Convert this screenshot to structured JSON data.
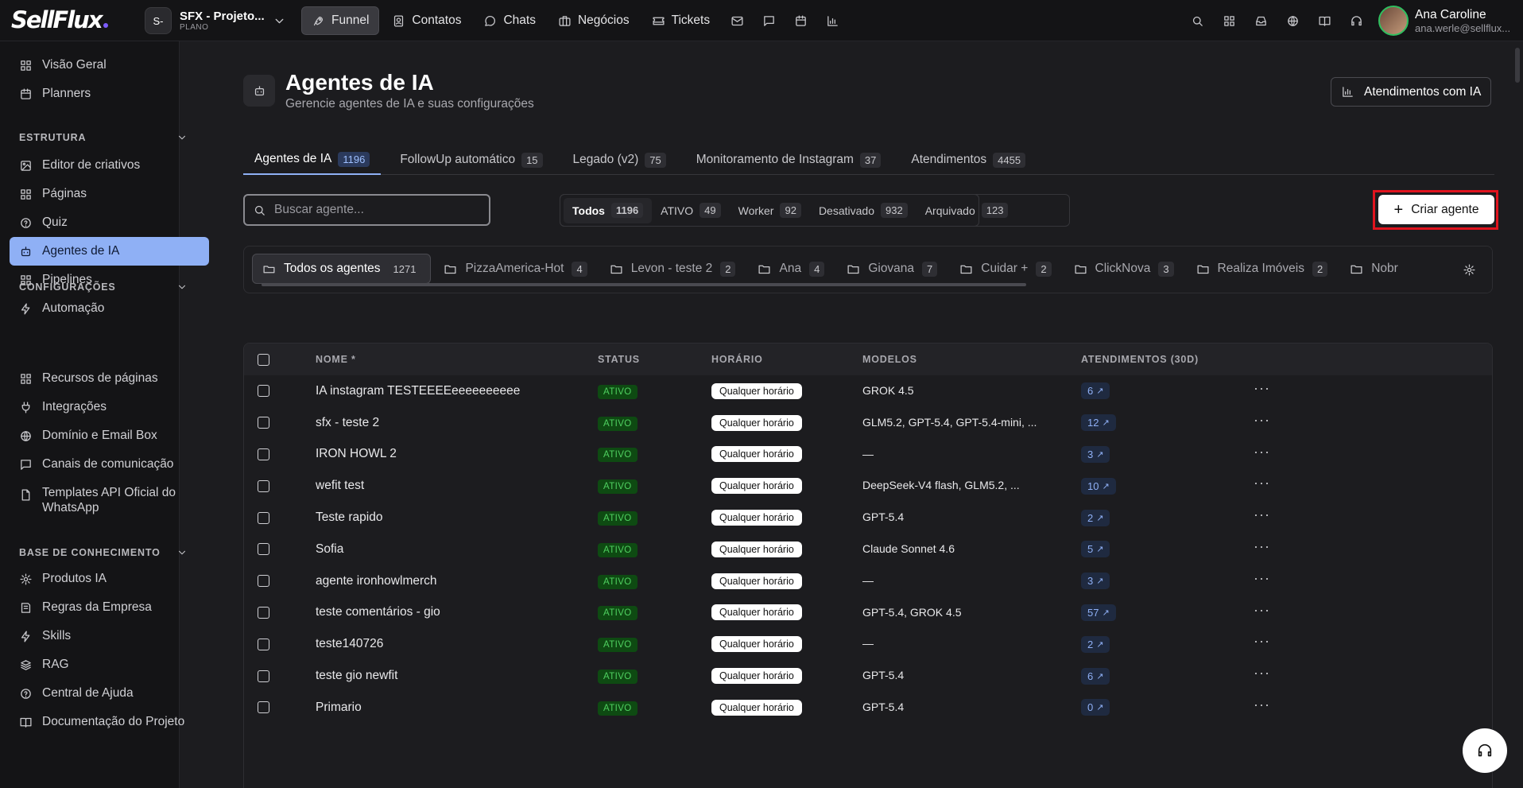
{
  "logo": "SellFlux",
  "project": {
    "avatar": "S-",
    "name": "SFX - Projeto...",
    "plan": "PLANO"
  },
  "nav": [
    {
      "label": "Funnel",
      "icon": "rocket-icon",
      "active": true
    },
    {
      "label": "Contatos",
      "icon": "contacts-icon"
    },
    {
      "label": "Chats",
      "icon": "chat-icon"
    },
    {
      "label": "Negócios",
      "icon": "briefcase-icon"
    },
    {
      "label": "Tickets",
      "icon": "ticket-icon"
    }
  ],
  "user": {
    "name": "Ana Caroline",
    "email": "ana.werle@sellflux..."
  },
  "sidebar": {
    "top": [
      "Visão Geral",
      "Planners"
    ],
    "estrutura": {
      "title": "ESTRUTURA",
      "items": [
        "Editor de criativos",
        "Páginas",
        "Quiz",
        "Agentes de IA",
        "Pipelines",
        "Automação"
      ]
    },
    "configuracoes": {
      "title": "CONFIGURAÇÕES",
      "items": [
        "Recursos de páginas",
        "Integrações",
        "Domínio e Email Box",
        "Canais de comunicação",
        "Templates API Oficial do WhatsApp"
      ]
    },
    "base": {
      "title": "BASE DE CONHECIMENTO",
      "items": [
        "Produtos IA",
        "Regras da Empresa",
        "Skills",
        "RAG",
        "Central de Ajuda",
        "Documentação do Projeto"
      ]
    }
  },
  "page": {
    "title": "Agentes de IA",
    "subtitle": "Gerencie agentes de IA e suas configurações",
    "atendimentos_btn": "Atendimentos com IA"
  },
  "tabs": [
    {
      "label": "Agentes de IA",
      "count": "1196"
    },
    {
      "label": "FollowUp automático",
      "count": "15"
    },
    {
      "label": "Legado (v2)",
      "count": "75"
    },
    {
      "label": "Monitoramento de Instagram",
      "count": "37"
    },
    {
      "label": "Atendimentos",
      "count": "4455"
    }
  ],
  "search": {
    "placeholder": "Buscar agente..."
  },
  "filters": [
    {
      "label": "Todos",
      "count": "1196"
    },
    {
      "label": "ATIVO",
      "count": "49"
    },
    {
      "label": "Worker",
      "count": "92"
    },
    {
      "label": "Desativado",
      "count": "932"
    },
    {
      "label": "Arquivado",
      "count": "123"
    }
  ],
  "create_btn": "Criar agente",
  "folders": [
    {
      "label": "Todos os agentes",
      "count": "1271"
    },
    {
      "label": "PizzaAmerica-Hot",
      "count": "4"
    },
    {
      "label": "Levon - teste 2",
      "count": "2"
    },
    {
      "label": "Ana",
      "count": "4"
    },
    {
      "label": "Giovana",
      "count": "7"
    },
    {
      "label": "Cuidar +",
      "count": "2"
    },
    {
      "label": "ClickNova",
      "count": "3"
    },
    {
      "label": "Realiza Imóveis",
      "count": "2"
    },
    {
      "label": "Nobr",
      "count": ""
    }
  ],
  "table": {
    "headers": {
      "nome": "NOME *",
      "status": "STATUS",
      "horario": "HORÁRIO",
      "modelos": "MODELOS",
      "atendimentos": "ATENDIMENTOS (30D)"
    },
    "rows": [
      {
        "nome": "IA instagram TESTEEEEeeeeeeeeee",
        "status": "ATIVO",
        "horario": "Qualquer horário",
        "modelos": "GROK 4.5",
        "atd": "6"
      },
      {
        "nome": "sfx - teste 2",
        "status": "ATIVO",
        "horario": "Qualquer horário",
        "modelos": "GLM5.2, GPT-5.4, GPT-5.4-mini, ...",
        "atd": "12"
      },
      {
        "nome": "IRON HOWL 2",
        "status": "ATIVO",
        "horario": "Qualquer horário",
        "modelos": "—",
        "atd": "3"
      },
      {
        "nome": "wefit test",
        "status": "ATIVO",
        "horario": "Qualquer horário",
        "modelos": "DeepSeek-V4 flash, GLM5.2, ...",
        "atd": "10"
      },
      {
        "nome": "Teste rapido",
        "status": "ATIVO",
        "horario": "Qualquer horário",
        "modelos": "GPT-5.4",
        "atd": "2"
      },
      {
        "nome": "Sofia",
        "status": "ATIVO",
        "horario": "Qualquer horário",
        "modelos": "Claude Sonnet 4.6",
        "atd": "5"
      },
      {
        "nome": "agente ironhowlmerch",
        "status": "ATIVO",
        "horario": "Qualquer horário",
        "modelos": "—",
        "atd": "3"
      },
      {
        "nome": "teste comentários - gio",
        "status": "ATIVO",
        "horario": "Qualquer horário",
        "modelos": "GPT-5.4, GROK 4.5",
        "atd": "57"
      },
      {
        "nome": "teste140726",
        "status": "ATIVO",
        "horario": "Qualquer horário",
        "modelos": "—",
        "atd": "2"
      },
      {
        "nome": "teste gio newfit",
        "status": "ATIVO",
        "horario": "Qualquer horário",
        "modelos": "GPT-5.4",
        "atd": "6"
      },
      {
        "nome": "Primario",
        "status": "ATIVO",
        "horario": "Qualquer horário",
        "modelos": "GPT-5.4",
        "atd": "0"
      }
    ]
  },
  "colors": {
    "accent": "#8fb0f5",
    "status_bg": "#0e4a12",
    "status_fg": "#4fd060",
    "highlight": "#e0141e"
  }
}
